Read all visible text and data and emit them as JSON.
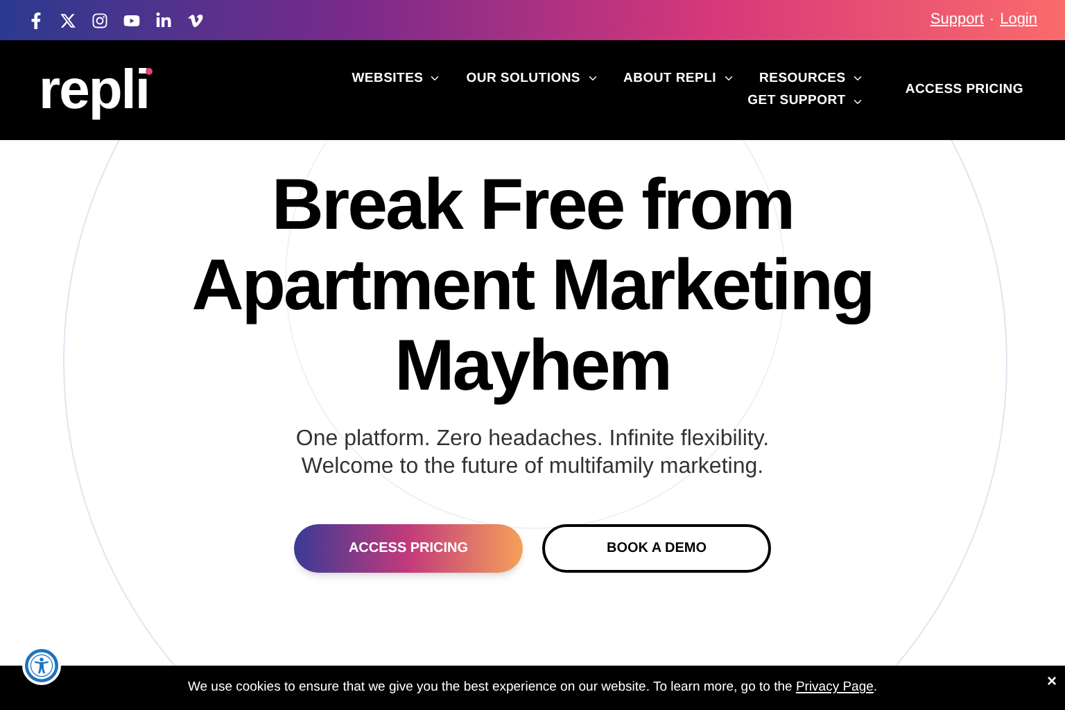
{
  "top_bar": {
    "links": [
      "Support",
      "Login"
    ],
    "separator": "·"
  },
  "header": {
    "logo": "repli",
    "nav": [
      {
        "label": "WEBSITES"
      },
      {
        "label": "OUR SOLUTIONS"
      },
      {
        "label": "ABOUT REPLI"
      },
      {
        "label": "RESOURCES"
      },
      {
        "label": "GET SUPPORT"
      }
    ],
    "cta": "ACCESS PRICING"
  },
  "hero": {
    "title": "Break Free from Apartment Marketing Mayhem",
    "subtitle": [
      "One platform. Zero headaches. Infinite flexibility.",
      "Welcome to the future of multifamily marketing."
    ],
    "buttons": [
      {
        "label": "ACCESS PRICING",
        "kind": "primary"
      },
      {
        "label": "BOOK A DEMO",
        "kind": "outline"
      }
    ]
  },
  "cookie_bar": {
    "text": "We use cookies to ensure that we give you the best experience on our website. To learn more, go to the",
    "link": "Privacy Page",
    "after": ".",
    "close": "×"
  }
}
